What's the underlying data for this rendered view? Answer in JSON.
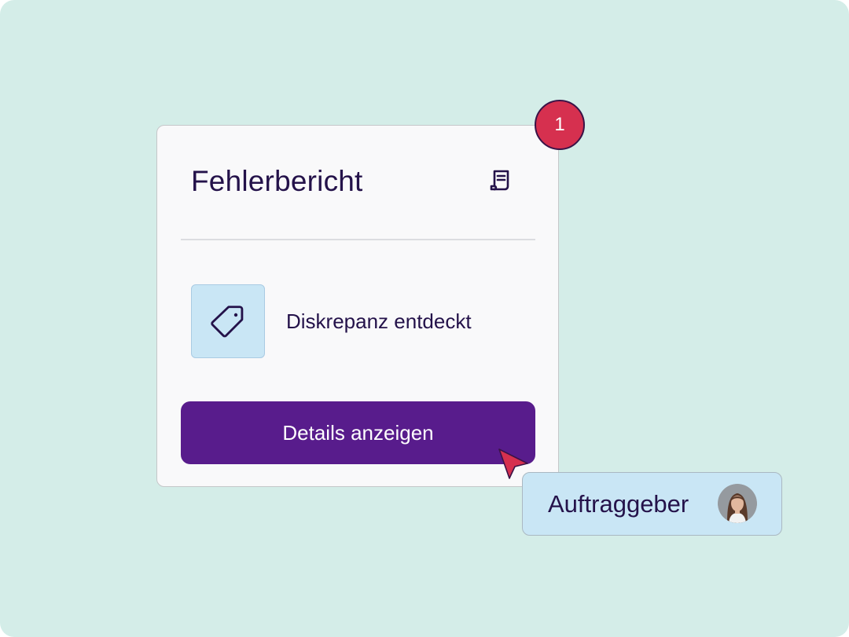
{
  "card": {
    "title": "Fehlerbericht",
    "title_icon": "receipt-icon",
    "item": {
      "icon": "price-tag-icon",
      "label": "Diskrepanz entdeckt"
    },
    "button_label": "Details anzeigen"
  },
  "notification_badge": {
    "count": "1"
  },
  "user_chip": {
    "label": "Auftraggeber",
    "avatar": "avatar-photo"
  },
  "colors": {
    "background": "#d4ede8",
    "card": "#f9f9fa",
    "text": "#24124a",
    "button": "#581c8c",
    "badge": "#d6304f",
    "tag_box": "#c9e6f5",
    "cursor": "#d6304f"
  }
}
